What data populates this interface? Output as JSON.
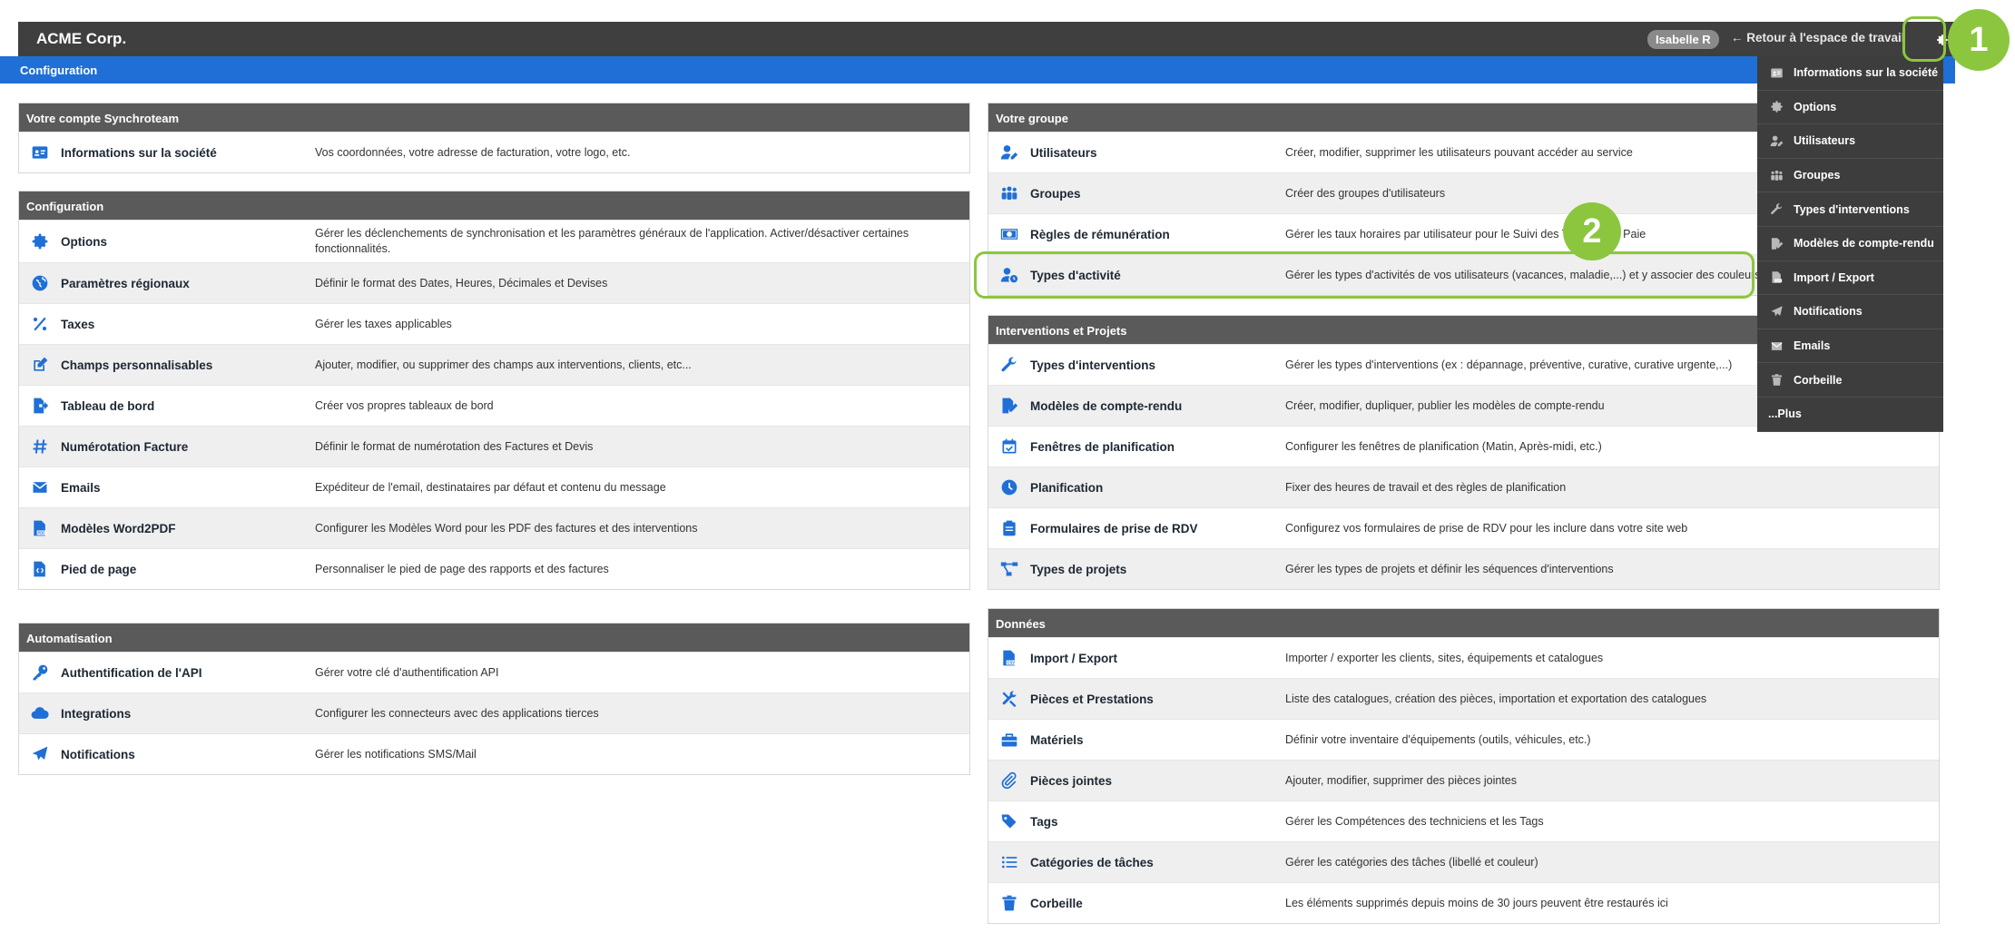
{
  "header": {
    "brand": "ACME Corp.",
    "user": "Isabelle R",
    "return_link": "← Retour à l'espace de travail"
  },
  "subheader": {
    "title": "Configuration"
  },
  "left": {
    "account": {
      "title": "Votre compte Synchroteam",
      "items": [
        {
          "label": "Informations sur la société",
          "desc": "Vos coordonnées, votre adresse de facturation, votre logo, etc.",
          "icon": "id-card-icon"
        }
      ]
    },
    "config": {
      "title": "Configuration",
      "items": [
        {
          "label": "Options",
          "desc": "Gérer les déclenchements de synchronisation et les paramètres généraux de l'application. Activer/désactiver certaines fonctionnalités.",
          "icon": "gear-icon"
        },
        {
          "label": "Paramètres régionaux",
          "desc": "Définir le format des Dates, Heures, Décimales et Devises",
          "icon": "globe-icon"
        },
        {
          "label": "Taxes",
          "desc": "Gérer les taxes applicables",
          "icon": "percent-icon"
        },
        {
          "label": "Champs personnalisables",
          "desc": "Ajouter, modifier, ou supprimer des champs aux interventions, clients, etc...",
          "icon": "edit-icon"
        },
        {
          "label": "Tableau de bord",
          "desc": "Créer vos propres tableaux de bord",
          "icon": "file-export-icon"
        },
        {
          "label": "Numérotation Facture",
          "desc": "Définir le format de numérotation des Factures et Devis",
          "icon": "hashtag-icon"
        },
        {
          "label": "Emails",
          "desc": "Expéditeur de l'email, destinataires par défaut et contenu du message",
          "icon": "envelope-icon"
        },
        {
          "label": "Modèles Word2PDF",
          "desc": "Configurer les Modèles Word pour les PDF des factures et des interventions",
          "icon": "file-pdf-icon"
        },
        {
          "label": "Pied de page",
          "desc": "Personnaliser le pied de page des rapports et des factures",
          "icon": "file-code-icon"
        }
      ]
    },
    "automation": {
      "title": "Automatisation",
      "items": [
        {
          "label": "Authentification de l'API",
          "desc": "Gérer votre clé d'authentification API",
          "icon": "key-icon"
        },
        {
          "label": "Integrations",
          "desc": "Configurer les connecteurs avec des applications tierces",
          "icon": "cloud-icon"
        },
        {
          "label": "Notifications",
          "desc": "Gérer les notifications SMS/Mail",
          "icon": "paper-plane-icon"
        }
      ]
    }
  },
  "right": {
    "group": {
      "title": "Votre groupe",
      "items": [
        {
          "label": "Utilisateurs",
          "desc": "Créer, modifier, supprimer les utilisateurs pouvant accéder au service",
          "icon": "user-edit-icon"
        },
        {
          "label": "Groupes",
          "desc": "Créer des groupes d'utilisateurs",
          "icon": "users-icon"
        },
        {
          "label": "Règles de rémunération",
          "desc": "Gérer les taux horaires par utilisateur pour le Suivi des Temps et la Paie",
          "icon": "money-bill-icon"
        },
        {
          "label": "Types d'activité",
          "desc": "Gérer les types d'activités de vos utilisateurs (vacances, maladie,...) et y associer des couleurs",
          "icon": "user-clock-icon"
        }
      ]
    },
    "interventions": {
      "title": "Interventions et Projets",
      "items": [
        {
          "label": "Types d'interventions",
          "desc": "Gérer les types d'interventions (ex : dépannage, préventive, curative, curative urgente,...)",
          "icon": "wrench-icon"
        },
        {
          "label": "Modèles de compte-rendu",
          "desc": "Créer, modifier, dupliquer, publier les modèles de compte-rendu",
          "icon": "file-signature-icon"
        },
        {
          "label": "Fenêtres de planification",
          "desc": "Configurer les fenêtres de planification (Matin, Après-midi, etc.)",
          "icon": "calendar-check-icon"
        },
        {
          "label": "Planification",
          "desc": "Fixer des heures de travail et des règles de planification",
          "icon": "clock-icon"
        },
        {
          "label": "Formulaires de prise de RDV",
          "desc": "Configurez vos formulaires de prise de RDV pour les inclure dans votre site web",
          "icon": "clipboard-icon"
        },
        {
          "label": "Types de projets",
          "desc": "Gérer les types de projets et définir les séquences d'interventions",
          "icon": "project-diagram-icon"
        }
      ]
    },
    "data": {
      "title": "Données",
      "items": [
        {
          "label": "Import / Export",
          "desc": "Importer / exporter les clients, sites, équipements et catalogues",
          "icon": "file-csv-icon"
        },
        {
          "label": "Pièces et Prestations",
          "desc": "Liste des catalogues, création des pièces, importation et exportation des catalogues",
          "icon": "tools-icon"
        },
        {
          "label": "Matériels",
          "desc": "Définir votre inventaire d'équipements (outils, véhicules, etc.)",
          "icon": "toolbox-icon"
        },
        {
          "label": "Pièces jointes",
          "desc": "Ajouter, modifier, supprimer des pièces jointes",
          "icon": "paperclip-icon"
        },
        {
          "label": "Tags",
          "desc": "Gérer les Compétences des techniciens et les Tags",
          "icon": "tags-icon"
        },
        {
          "label": "Catégories de tâches",
          "desc": "Gérer les catégories des tâches (libellé et couleur)",
          "icon": "list-icon"
        },
        {
          "label": "Corbeille",
          "desc": "Les éléments supprimés depuis moins de 30 jours peuvent être restaurés ici",
          "icon": "trash-icon"
        }
      ]
    }
  },
  "dropdown": {
    "items": [
      {
        "label": "Informations sur la société",
        "icon": "id-card-icon"
      },
      {
        "label": "Options",
        "icon": "gear-icon"
      },
      {
        "label": "Utilisateurs",
        "icon": "user-edit-icon"
      },
      {
        "label": "Groupes",
        "icon": "users-icon"
      },
      {
        "label": "Types d'interventions",
        "icon": "wrench-icon"
      },
      {
        "label": "Modèles de compte-rendu",
        "icon": "file-signature-icon"
      },
      {
        "label": "Import / Export",
        "icon": "file-csv-icon"
      },
      {
        "label": "Notifications",
        "icon": "paper-plane-icon"
      },
      {
        "label": "Emails",
        "icon": "envelope-icon"
      },
      {
        "label": "Corbeille",
        "icon": "trash-icon"
      }
    ],
    "more": "...Plus"
  },
  "callouts": {
    "one": "1",
    "two": "2"
  },
  "colors": {
    "topbar": "#3f3f3f",
    "accent_blue": "#1f6fd6",
    "icon_blue": "#1f6fd6",
    "highlight_green": "#8cc63f",
    "section_header": "#5a5a5a"
  }
}
